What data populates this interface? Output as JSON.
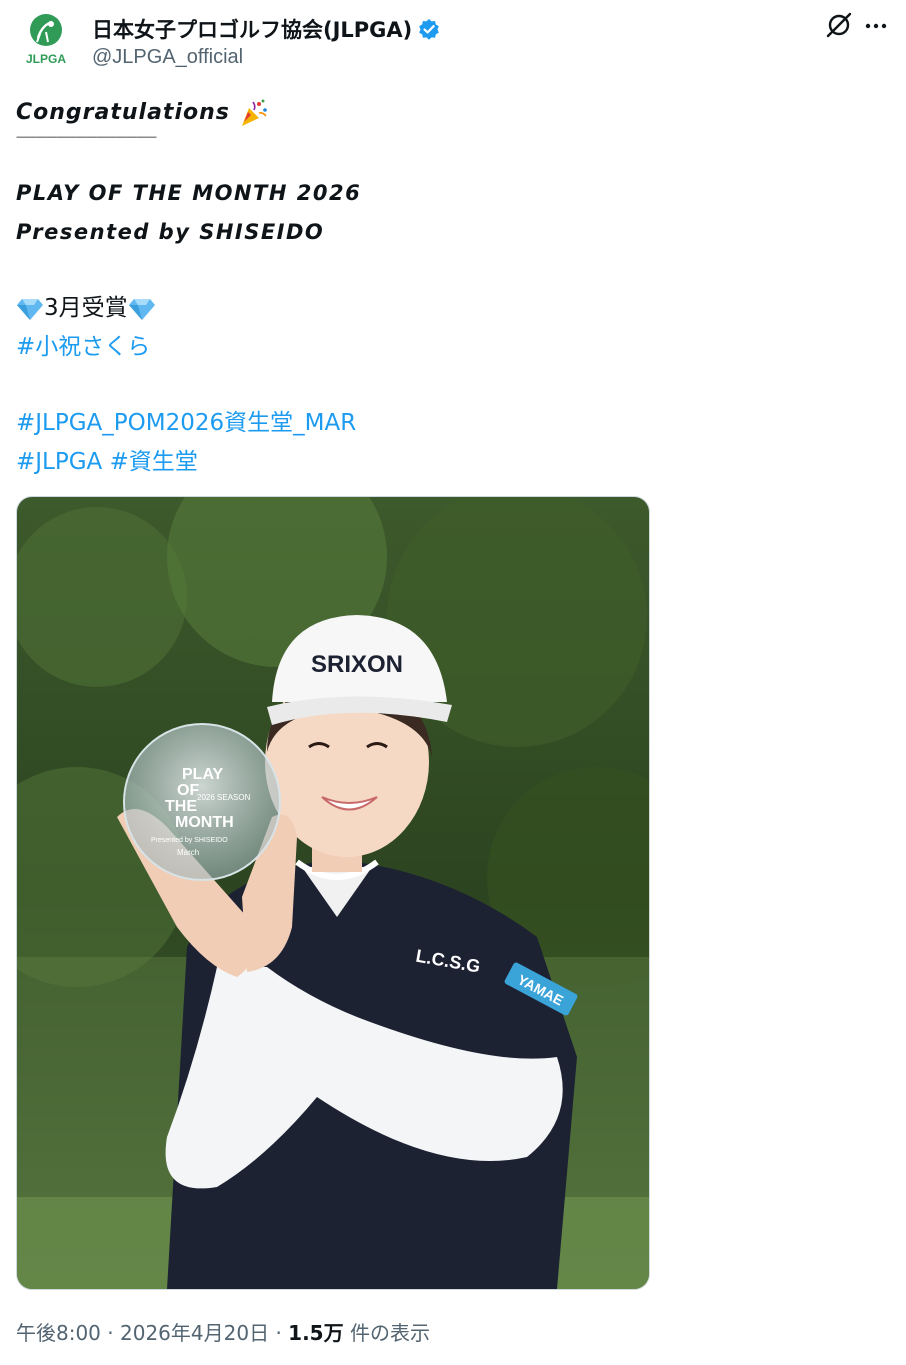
{
  "account": {
    "display_name": "日本女子プロゴルフ協会(JLPGA)",
    "handle": "@JLPGA_official",
    "logo_text": "JLPGA",
    "verified_color": "#1d9bf0"
  },
  "tweet": {
    "congrats": "Congratulations",
    "rule": "——————————————",
    "title_line1": "PLAY OF THE MONTH 2026",
    "title_line2": "Presented by SHISEIDO",
    "award": "3月受賞",
    "hashtag_player": "#小祝さくら",
    "hashtag_pom": "#JLPGA_POM2026資生堂_MAR",
    "hashtag_jlpga": "#JLPGA",
    "hashtag_shiseido": "#資生堂"
  },
  "media": {
    "trophy_line1": "PLAY",
    "trophy_line2": "OF",
    "trophy_line3": "THE",
    "trophy_line4": "MONTH",
    "trophy_season": "2026 SEASON",
    "trophy_presented": "Presented by SHISEIDO",
    "trophy_month": "March",
    "cap_logo": "SRIXON",
    "shirt_text": "L.C.S.G",
    "sleeve_patch": "YAMAE"
  },
  "meta": {
    "time": "午後8:00",
    "sep": "·",
    "date": "2026年4月20日",
    "views_count": "1.5万",
    "views_label": "件の表示"
  },
  "colors": {
    "link": "#1d9bf0",
    "text": "#0f1419",
    "muted": "#536471",
    "logo_green": "#2f9b57"
  },
  "icons": [
    "avatar-logo-icon",
    "verified-badge-icon",
    "grok-icon",
    "more-icon",
    "party-popper-icon",
    "gem-icon"
  ]
}
